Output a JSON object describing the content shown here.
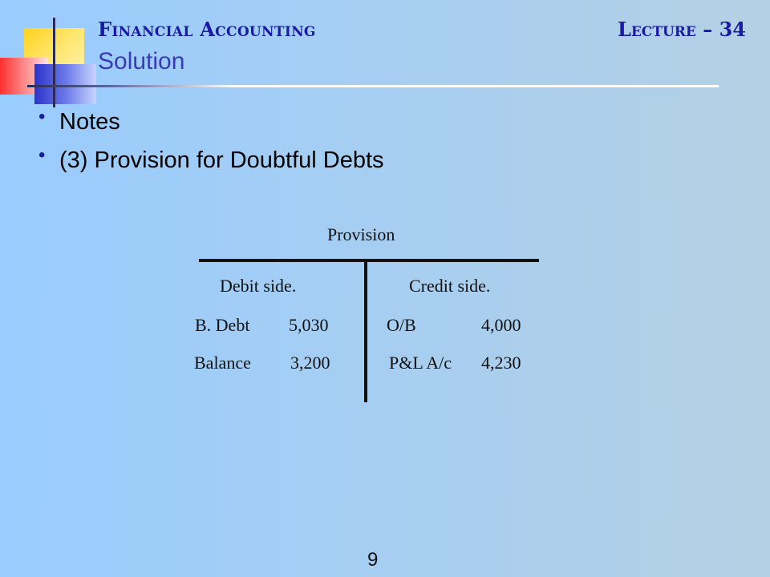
{
  "header": {
    "course": "Financial Accounting",
    "lecture": "Lecture – 34",
    "title": "Solution"
  },
  "bullets": [
    "Notes",
    "(3) Provision for Doubtful Debts"
  ],
  "account": {
    "title": "Provision",
    "debit_header": "Debit side.",
    "credit_header": "Credit side.",
    "debit_rows": [
      {
        "label": "B. Debt",
        "amount": "5,030"
      },
      {
        "label": "Balance",
        "amount": "3,200"
      }
    ],
    "credit_rows": [
      {
        "label": "O/B",
        "amount": "4,000"
      },
      {
        "label": "P&L A/c",
        "amount": "4,230"
      }
    ]
  },
  "footer": {
    "page_number": "9"
  }
}
